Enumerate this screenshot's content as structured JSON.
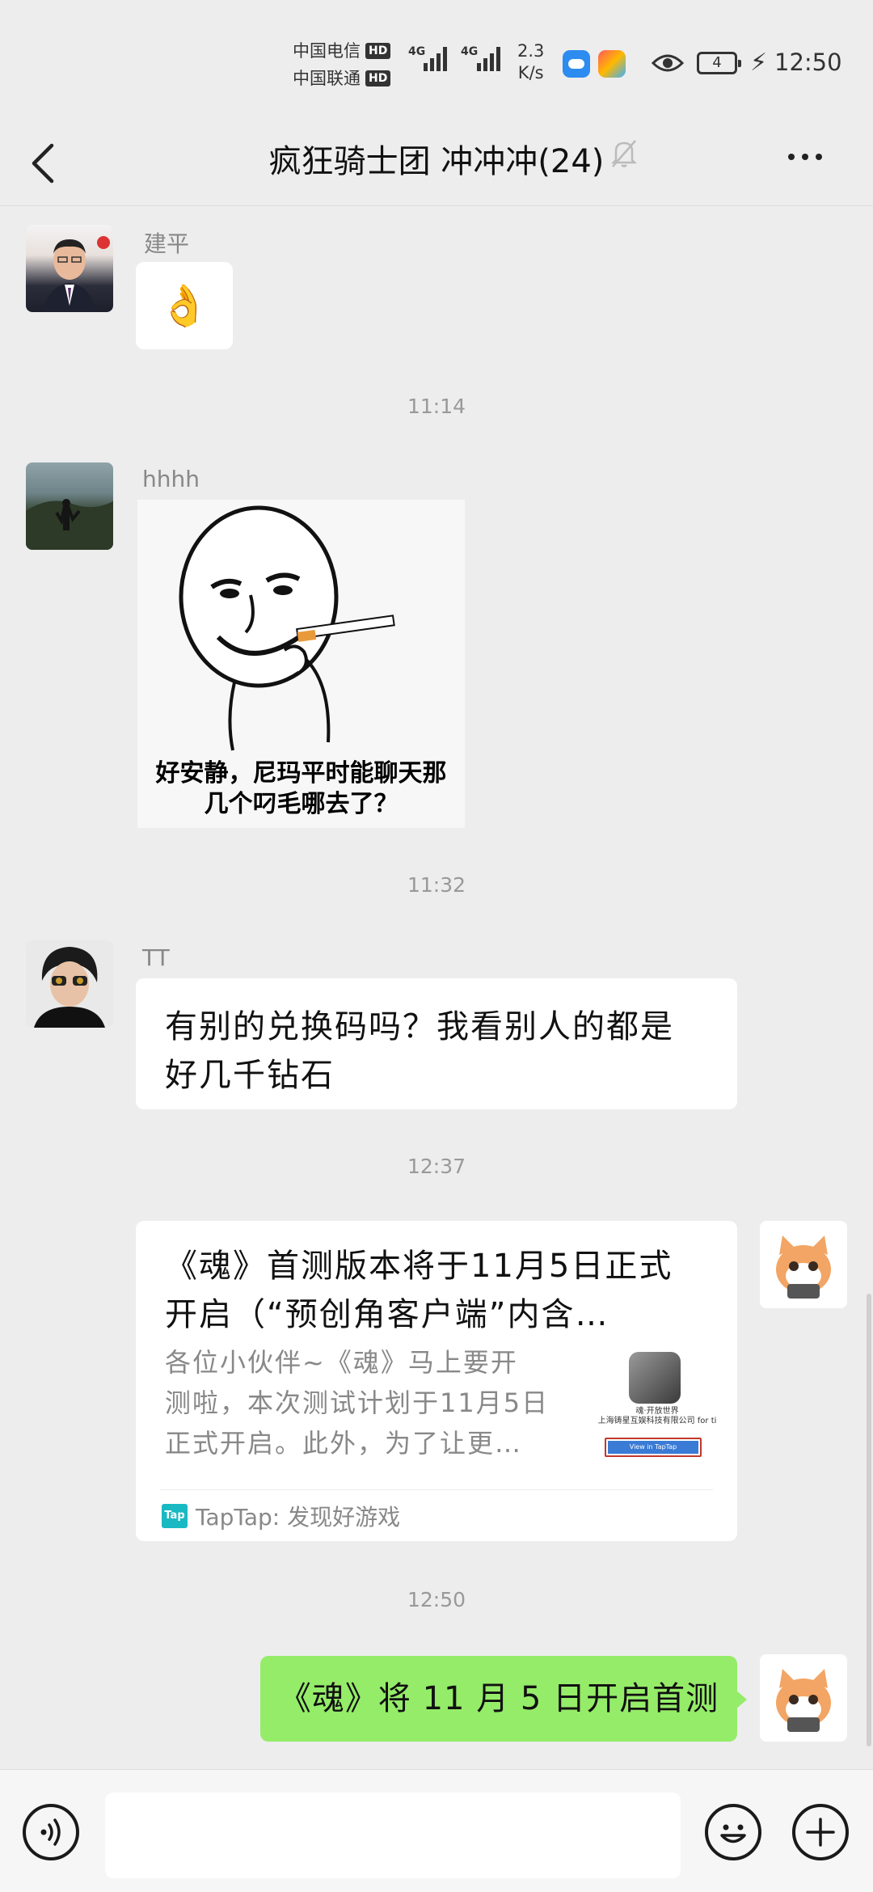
{
  "status": {
    "carrier1": "中国电信",
    "carrier2": "中国联通",
    "hd": "HD",
    "net": "4G",
    "speed_val": "2.3",
    "speed_unit": "K/s",
    "battery": "4",
    "time": "12:50"
  },
  "header": {
    "title": "疯狂骑士团 冲冲冲(24)"
  },
  "messages": {
    "m1": {
      "name": "建平",
      "content": "👌"
    },
    "t1": "11:14",
    "m2": {
      "name": "hhhh",
      "sticker_caption_1": "好安静，尼玛平时能聊天那",
      "sticker_caption_2": "几个叼毛哪去了？"
    },
    "t2": "11:32",
    "m3": {
      "name": "TT",
      "line1": "有别的兑换码吗？我看别人的都是",
      "line2": "好几千钻石"
    },
    "t3": "12:37",
    "m4": {
      "title1": "《魂》首测版本将于11月5日正式",
      "title2": "开启（“预创角客户端”内含…",
      "desc1": "各位小伙伴~《魂》马上要开",
      "desc2": "测啦，本次测试计划于11月5日",
      "desc3": "正式开启。此外，为了让更…",
      "thumb_line1": "魂·开放世界",
      "thumb_line2": "上海铸星互娱科技有限公司 for ti",
      "thumb_btn": "View in TapTap",
      "source_icon": "Tap",
      "source": "TapTap: 发现好游戏"
    },
    "t4": "12:50",
    "m5": {
      "content": "《魂》将 11 月 5 日开启首测"
    }
  }
}
